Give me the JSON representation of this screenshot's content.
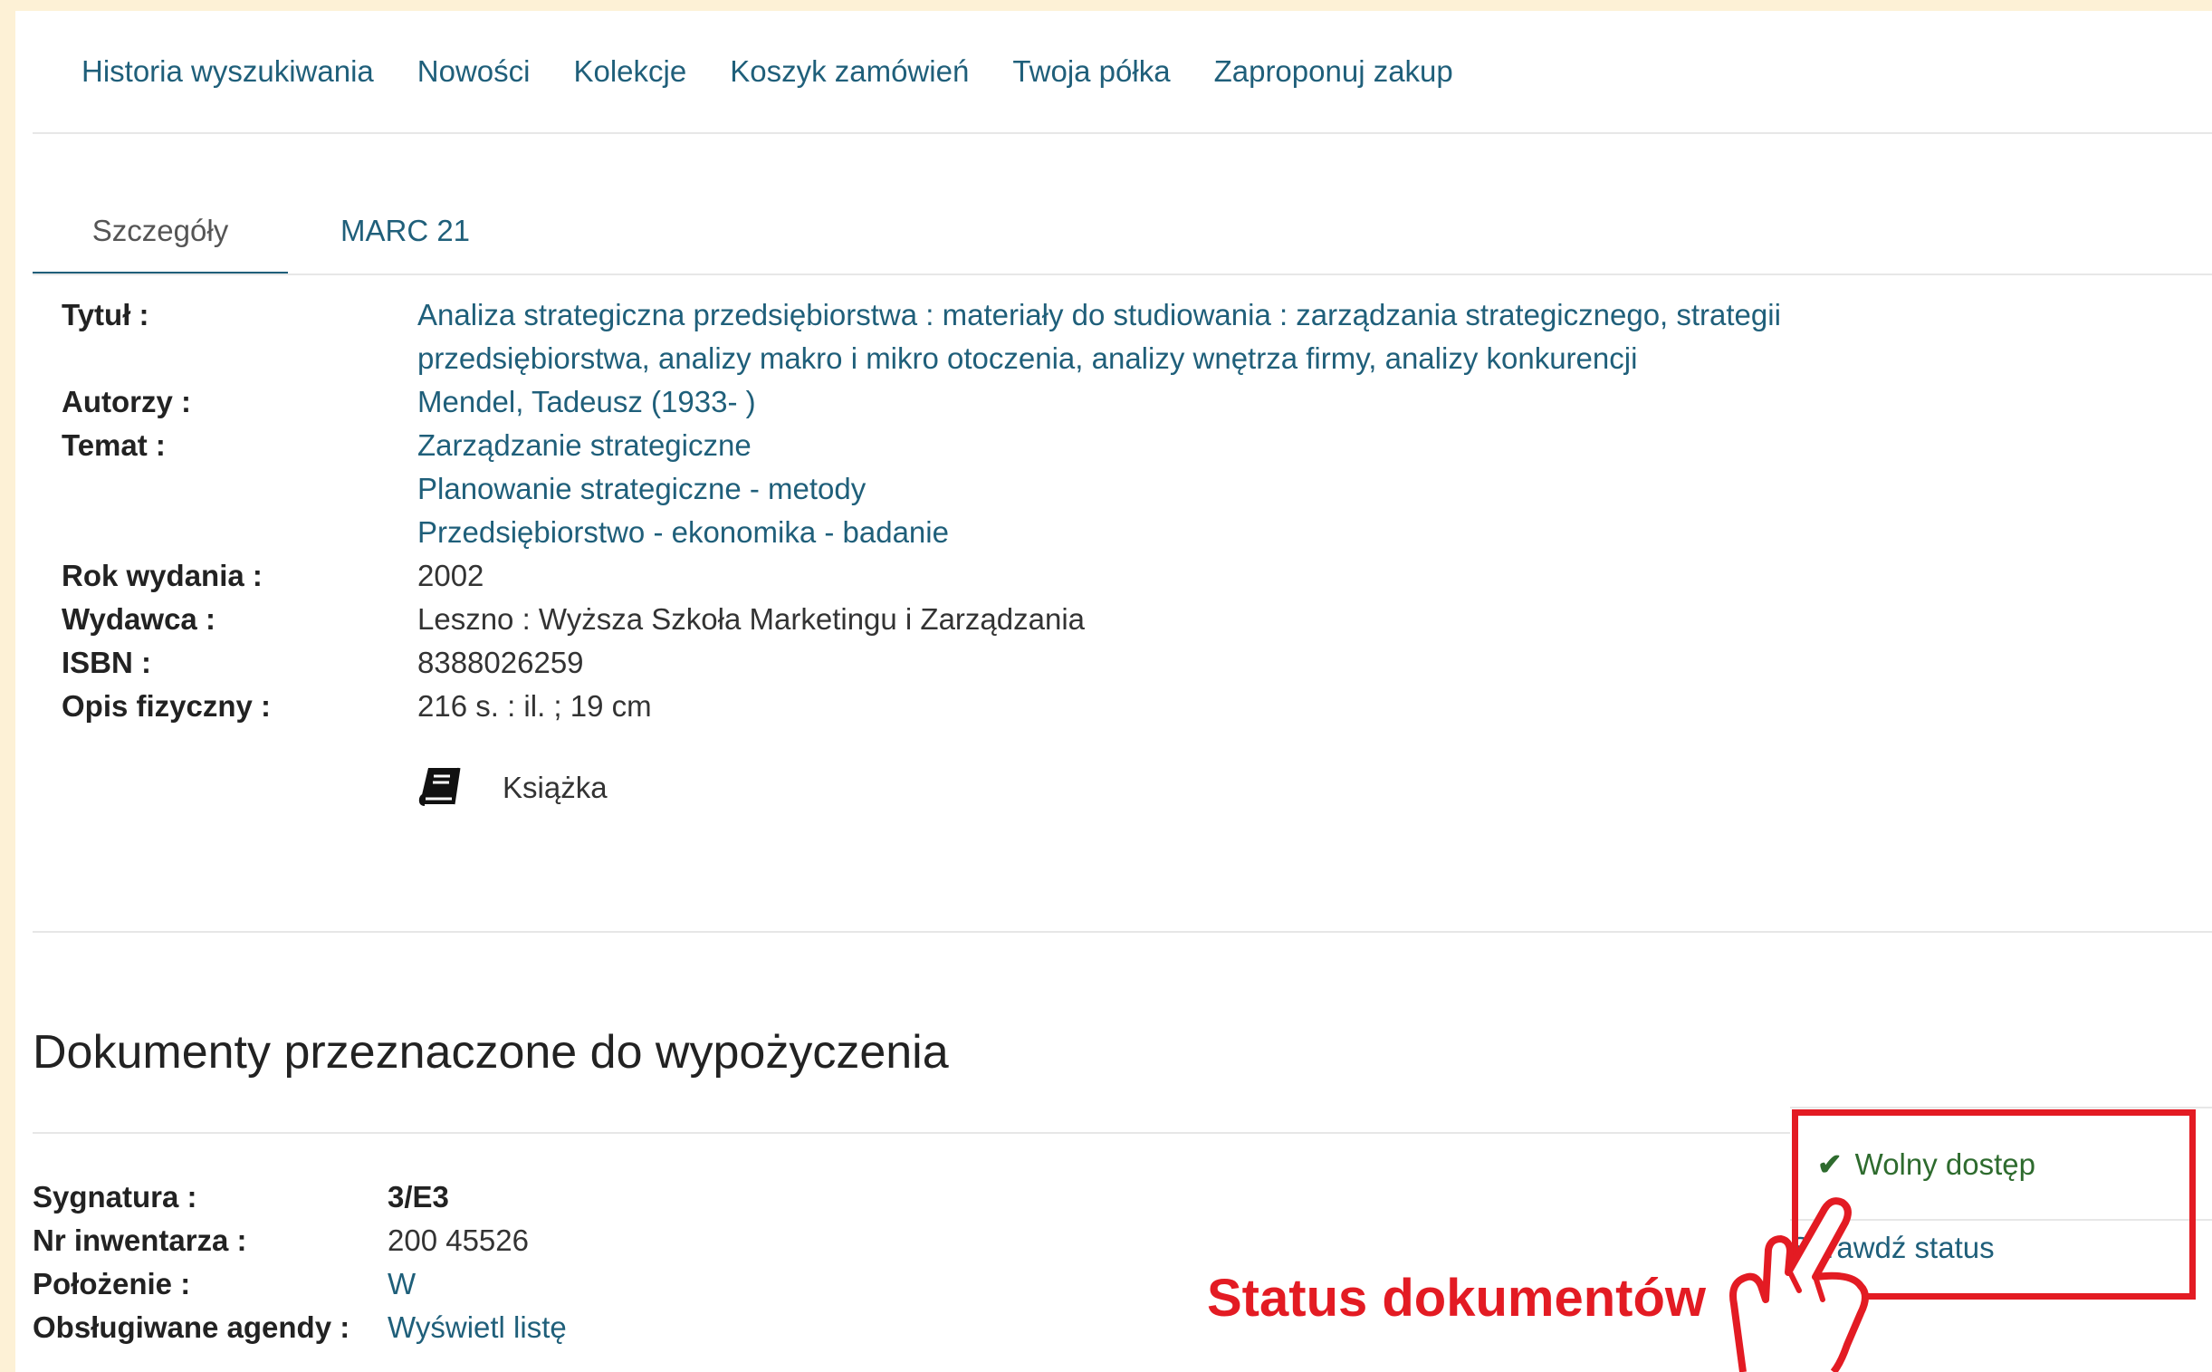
{
  "nav": [
    "Historia wyszukiwania",
    "Nowości",
    "Kolekcje",
    "Koszyk zamówień",
    "Twoja półka",
    "Zaproponuj zakup"
  ],
  "tabs": {
    "details": "Szczegóły",
    "marc": "MARC 21"
  },
  "record": {
    "title_label": "Tytuł :",
    "title_line1": "Analiza strategiczna przedsiębiorstwa : materiały do studiowania : zarządzania strategicznego, strategii",
    "title_line2": "przedsiębiorstwa, analizy makro i mikro otoczenia, analizy wnętrza firmy, analizy konkurencji",
    "authors_label": "Autorzy :",
    "authors": "Mendel, Tadeusz (1933- )",
    "subject_label": "Temat :",
    "subjects": [
      "Zarządzanie strategiczne",
      "Planowanie strategiczne - metody",
      "Przedsiębiorstwo - ekonomika - badanie"
    ],
    "year_label": "Rok wydania :",
    "year": "2002",
    "publisher_label": "Wydawca :",
    "publisher": "Leszno : Wyższa Szkoła Marketingu i Zarządzania",
    "isbn_label": "ISBN :",
    "isbn": "8388026259",
    "physical_label": "Opis fizyczny :",
    "physical": "216 s. : il. ; 19 cm",
    "type": "Książka",
    "type_icon": "book-icon"
  },
  "documents": {
    "heading": "Dokumenty przeznaczone do wypożyczenia",
    "signature_label": "Sygnatura :",
    "signature": "3/E3",
    "inventory_label": "Nr inwentarza :",
    "inventory": "200 45526",
    "location_label": "Położenie :",
    "location": "W",
    "agendas_label": "Obsługiwane agendy :",
    "agendas_link": "Wyświetl listę",
    "status_free": "Wolny dostęp",
    "status_check": "Sprawdź status"
  },
  "annotation": {
    "text": "Status dokumentów",
    "color": "#e31b23"
  },
  "colors": {
    "link": "#1f5f7a",
    "background": "#fdf1d6",
    "status_ok": "#2e6b2e"
  }
}
